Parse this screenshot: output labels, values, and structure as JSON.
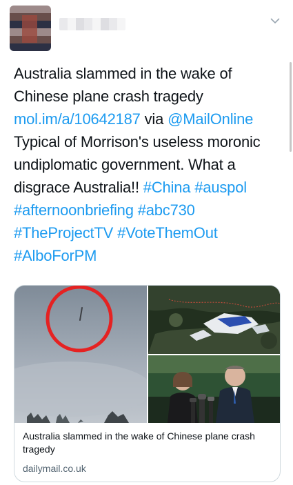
{
  "tweet": {
    "text_parts": {
      "t1": "Australia slammed in the wake of Chinese plane crash tragedy ",
      "l1": "mol.im/a/10642187",
      "t2": " via ",
      "l2": "@MailOnline",
      "t3": " Typical of Morrison's useless moronic undiplomatic government. What a disgrace Australia!! ",
      "h1": "#China",
      "sp1": " ",
      "h2": "#auspol",
      "sp2": " ",
      "h3": "#afternoonbriefing",
      "sp3": " ",
      "h4": "#abc730",
      "sp4": " ",
      "h5": "#TheProjectTV",
      "sp5": " ",
      "h6": "#VoteThemOut",
      "sp6": " ",
      "h7": "#AlboForPM"
    }
  },
  "card": {
    "title": "Australia slammed in the wake of Chinese plane crash tragedy",
    "domain": "dailymail.co.uk"
  },
  "colors": {
    "text": "#0f1419",
    "link": "#1d9bf0",
    "secondary": "#536471",
    "border": "#cfd9de",
    "circle_red": "#e52222"
  },
  "icons": {
    "more": "chevron-down-icon"
  }
}
